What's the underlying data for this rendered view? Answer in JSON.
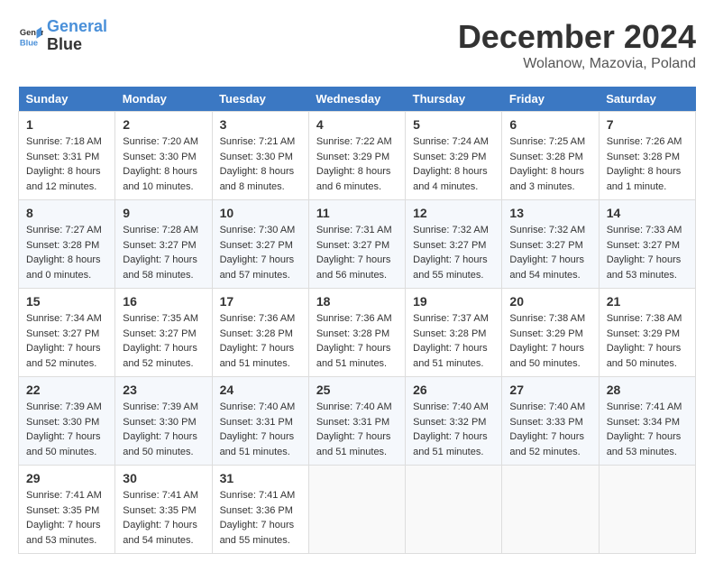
{
  "header": {
    "logo_line1": "General",
    "logo_line2": "Blue",
    "month_title": "December 2024",
    "subtitle": "Wolanow, Mazovia, Poland"
  },
  "days_of_week": [
    "Sunday",
    "Monday",
    "Tuesday",
    "Wednesday",
    "Thursday",
    "Friday",
    "Saturday"
  ],
  "weeks": [
    [
      {
        "day": 1,
        "sunrise": "Sunrise: 7:18 AM",
        "sunset": "Sunset: 3:31 PM",
        "daylight": "Daylight: 8 hours and 12 minutes."
      },
      {
        "day": 2,
        "sunrise": "Sunrise: 7:20 AM",
        "sunset": "Sunset: 3:30 PM",
        "daylight": "Daylight: 8 hours and 10 minutes."
      },
      {
        "day": 3,
        "sunrise": "Sunrise: 7:21 AM",
        "sunset": "Sunset: 3:30 PM",
        "daylight": "Daylight: 8 hours and 8 minutes."
      },
      {
        "day": 4,
        "sunrise": "Sunrise: 7:22 AM",
        "sunset": "Sunset: 3:29 PM",
        "daylight": "Daylight: 8 hours and 6 minutes."
      },
      {
        "day": 5,
        "sunrise": "Sunrise: 7:24 AM",
        "sunset": "Sunset: 3:29 PM",
        "daylight": "Daylight: 8 hours and 4 minutes."
      },
      {
        "day": 6,
        "sunrise": "Sunrise: 7:25 AM",
        "sunset": "Sunset: 3:28 PM",
        "daylight": "Daylight: 8 hours and 3 minutes."
      },
      {
        "day": 7,
        "sunrise": "Sunrise: 7:26 AM",
        "sunset": "Sunset: 3:28 PM",
        "daylight": "Daylight: 8 hours and 1 minute."
      }
    ],
    [
      {
        "day": 8,
        "sunrise": "Sunrise: 7:27 AM",
        "sunset": "Sunset: 3:28 PM",
        "daylight": "Daylight: 8 hours and 0 minutes."
      },
      {
        "day": 9,
        "sunrise": "Sunrise: 7:28 AM",
        "sunset": "Sunset: 3:27 PM",
        "daylight": "Daylight: 7 hours and 58 minutes."
      },
      {
        "day": 10,
        "sunrise": "Sunrise: 7:30 AM",
        "sunset": "Sunset: 3:27 PM",
        "daylight": "Daylight: 7 hours and 57 minutes."
      },
      {
        "day": 11,
        "sunrise": "Sunrise: 7:31 AM",
        "sunset": "Sunset: 3:27 PM",
        "daylight": "Daylight: 7 hours and 56 minutes."
      },
      {
        "day": 12,
        "sunrise": "Sunrise: 7:32 AM",
        "sunset": "Sunset: 3:27 PM",
        "daylight": "Daylight: 7 hours and 55 minutes."
      },
      {
        "day": 13,
        "sunrise": "Sunrise: 7:32 AM",
        "sunset": "Sunset: 3:27 PM",
        "daylight": "Daylight: 7 hours and 54 minutes."
      },
      {
        "day": 14,
        "sunrise": "Sunrise: 7:33 AM",
        "sunset": "Sunset: 3:27 PM",
        "daylight": "Daylight: 7 hours and 53 minutes."
      }
    ],
    [
      {
        "day": 15,
        "sunrise": "Sunrise: 7:34 AM",
        "sunset": "Sunset: 3:27 PM",
        "daylight": "Daylight: 7 hours and 52 minutes."
      },
      {
        "day": 16,
        "sunrise": "Sunrise: 7:35 AM",
        "sunset": "Sunset: 3:27 PM",
        "daylight": "Daylight: 7 hours and 52 minutes."
      },
      {
        "day": 17,
        "sunrise": "Sunrise: 7:36 AM",
        "sunset": "Sunset: 3:28 PM",
        "daylight": "Daylight: 7 hours and 51 minutes."
      },
      {
        "day": 18,
        "sunrise": "Sunrise: 7:36 AM",
        "sunset": "Sunset: 3:28 PM",
        "daylight": "Daylight: 7 hours and 51 minutes."
      },
      {
        "day": 19,
        "sunrise": "Sunrise: 7:37 AM",
        "sunset": "Sunset: 3:28 PM",
        "daylight": "Daylight: 7 hours and 51 minutes."
      },
      {
        "day": 20,
        "sunrise": "Sunrise: 7:38 AM",
        "sunset": "Sunset: 3:29 PM",
        "daylight": "Daylight: 7 hours and 50 minutes."
      },
      {
        "day": 21,
        "sunrise": "Sunrise: 7:38 AM",
        "sunset": "Sunset: 3:29 PM",
        "daylight": "Daylight: 7 hours and 50 minutes."
      }
    ],
    [
      {
        "day": 22,
        "sunrise": "Sunrise: 7:39 AM",
        "sunset": "Sunset: 3:30 PM",
        "daylight": "Daylight: 7 hours and 50 minutes."
      },
      {
        "day": 23,
        "sunrise": "Sunrise: 7:39 AM",
        "sunset": "Sunset: 3:30 PM",
        "daylight": "Daylight: 7 hours and 50 minutes."
      },
      {
        "day": 24,
        "sunrise": "Sunrise: 7:40 AM",
        "sunset": "Sunset: 3:31 PM",
        "daylight": "Daylight: 7 hours and 51 minutes."
      },
      {
        "day": 25,
        "sunrise": "Sunrise: 7:40 AM",
        "sunset": "Sunset: 3:31 PM",
        "daylight": "Daylight: 7 hours and 51 minutes."
      },
      {
        "day": 26,
        "sunrise": "Sunrise: 7:40 AM",
        "sunset": "Sunset: 3:32 PM",
        "daylight": "Daylight: 7 hours and 51 minutes."
      },
      {
        "day": 27,
        "sunrise": "Sunrise: 7:40 AM",
        "sunset": "Sunset: 3:33 PM",
        "daylight": "Daylight: 7 hours and 52 minutes."
      },
      {
        "day": 28,
        "sunrise": "Sunrise: 7:41 AM",
        "sunset": "Sunset: 3:34 PM",
        "daylight": "Daylight: 7 hours and 53 minutes."
      }
    ],
    [
      {
        "day": 29,
        "sunrise": "Sunrise: 7:41 AM",
        "sunset": "Sunset: 3:35 PM",
        "daylight": "Daylight: 7 hours and 53 minutes."
      },
      {
        "day": 30,
        "sunrise": "Sunrise: 7:41 AM",
        "sunset": "Sunset: 3:35 PM",
        "daylight": "Daylight: 7 hours and 54 minutes."
      },
      {
        "day": 31,
        "sunrise": "Sunrise: 7:41 AM",
        "sunset": "Sunset: 3:36 PM",
        "daylight": "Daylight: 7 hours and 55 minutes."
      },
      null,
      null,
      null,
      null
    ]
  ]
}
